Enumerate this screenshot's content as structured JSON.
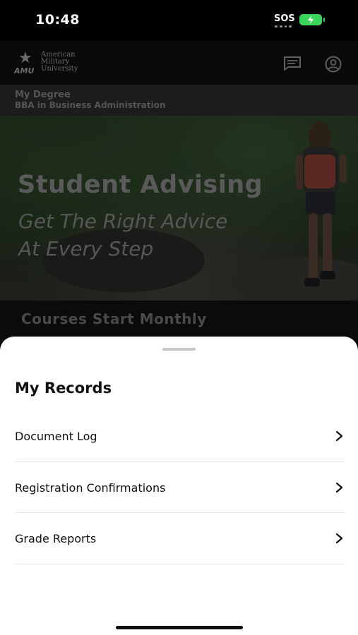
{
  "status_bar": {
    "time": "10:48",
    "sos": "SOS",
    "battery_color": "#3ad65a"
  },
  "header": {
    "logo_abbr": "AMU",
    "logo_line1": "American",
    "logo_line2": "Military",
    "logo_line3": "University",
    "icons": [
      "star-icon",
      "chat-icon",
      "account-icon"
    ]
  },
  "degree": {
    "title": "My Degree",
    "program": "BBA in Business Administration"
  },
  "hero": {
    "title": "Student Advising",
    "subtitle_line1": "Get The Right Advice",
    "subtitle_line2": "At Every Step"
  },
  "banner": {
    "text": "Courses Start Monthly"
  },
  "sheet": {
    "title": "My Records",
    "items": [
      {
        "label": "Document Log"
      },
      {
        "label": "Registration Confirmations"
      },
      {
        "label": "Grade Reports"
      }
    ]
  }
}
